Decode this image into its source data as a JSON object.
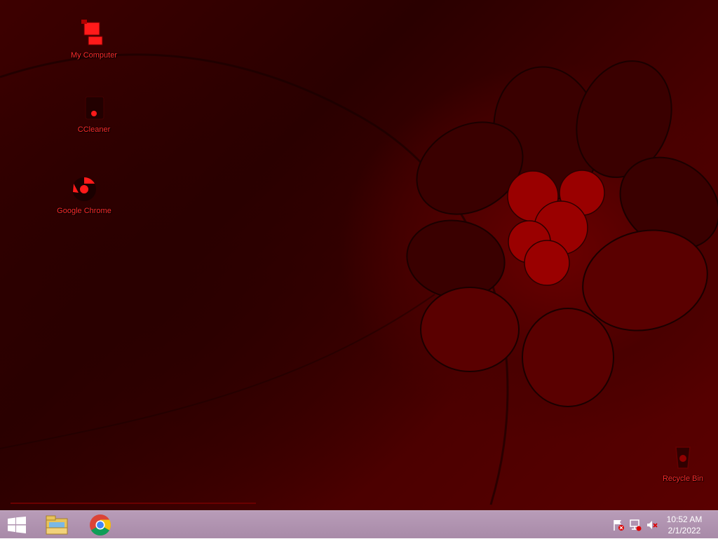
{
  "desktop": {
    "icons": [
      {
        "id": "computer",
        "label": "My Computer",
        "icon": "computer-icon"
      },
      {
        "id": "ccleaner",
        "label": "CCleaner",
        "icon": "ccleaner-icon"
      },
      {
        "id": "chrome",
        "label": "Google Chrome",
        "icon": "chrome-icon"
      },
      {
        "id": "recycle",
        "label": "Recycle Bin",
        "icon": "recycle-bin-icon"
      }
    ]
  },
  "taskbar": {
    "start_icon": "windows-logo-icon",
    "pinned": [
      {
        "id": "explorer",
        "icon": "file-explorer-icon"
      },
      {
        "id": "chrome",
        "icon": "chrome-icon"
      }
    ],
    "tray": {
      "icons": [
        "action-center-flag-icon",
        "network-icon",
        "volume-muted-icon"
      ]
    },
    "clock": {
      "time": "10:52 AM",
      "date": "2/1/2022"
    }
  },
  "colors": {
    "wallpaper": "#3d0000",
    "icon_label": "#ff2a2a",
    "taskbar": "#b89cb8"
  }
}
